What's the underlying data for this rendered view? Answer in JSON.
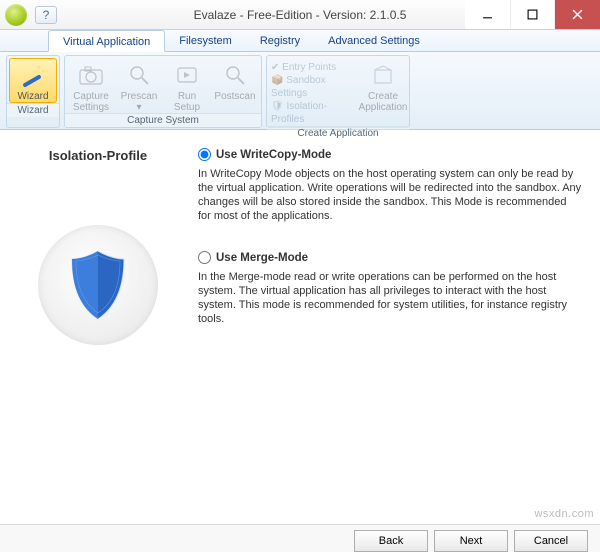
{
  "window": {
    "title": "Evalaze - Free-Edition - Version: 2.1.0.5"
  },
  "tabs": {
    "virtual_application": "Virtual Application",
    "filesystem": "Filesystem",
    "registry": "Registry",
    "advanced": "Advanced Settings"
  },
  "ribbon": {
    "wizard_group": "Wizard",
    "wizard_btn": "Wizard",
    "capture_group": "Capture System",
    "capture_settings": "Capture Settings",
    "prescan": "Prescan ▾",
    "run_setup": "Run Setup",
    "postscan": "Postscan",
    "create_group": "Create Application",
    "entry_points": "Entry Points",
    "sandbox_settings": "Sandbox Settings",
    "isolation_profiles": "Isolation-Profiles",
    "create_app": "Create Application"
  },
  "content": {
    "section_title": "Isolation-Profile",
    "opt1_label": "Use WriteCopy-Mode",
    "opt1_desc": "In WriteCopy Mode objects on the host operating system can only be read by the virtual application. Write operations will be redirected into the sandbox. Any changes will be also stored inside the sandbox. This Mode is recommended for most of the applications.",
    "opt2_label": "Use Merge-Mode",
    "opt2_desc": "In the Merge-mode read or write operations can be performed on the host system. The virtual application has all privileges to interact with the host system. This mode is recommended for system utilities, for instance registry tools."
  },
  "footer": {
    "back": "Back",
    "next": "Next",
    "cancel": "Cancel"
  },
  "watermark": "wsxdn.com"
}
